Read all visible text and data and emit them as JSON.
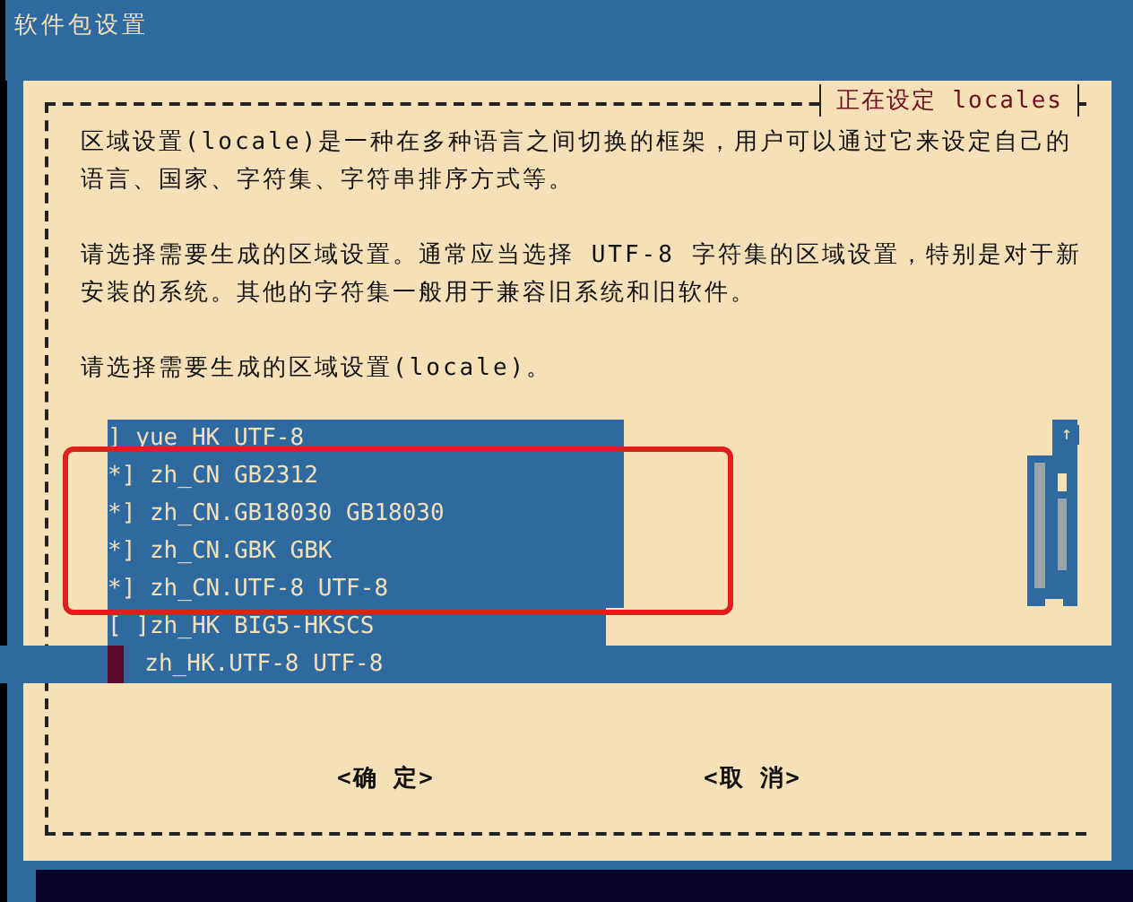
{
  "window": {
    "title": "软件包设置"
  },
  "dialog": {
    "title": "正在设定 locales",
    "paragraphs": [
      "区域设置(locale)是一种在多种语言之间切换的框架，用户可以通过它来设定自己的语言、国家、字符集、字符串排序方式等。",
      "请选择需要生成的区域设置。通常应当选择 UTF-8 字符集的区域设置，特别是对于新安装的系统。其他的字符集一般用于兼容旧系统和旧软件。",
      "请选择需要生成的区域设置(locale)。"
    ],
    "list": [
      {
        "prefix": "]",
        "label": "yue_HK UTF-8",
        "selected": false,
        "highlighted": false
      },
      {
        "prefix": "*]",
        "label": "zh_CN GB2312",
        "selected": false,
        "highlighted": true
      },
      {
        "prefix": "*]",
        "label": "zh_CN.GB18030 GB18030",
        "selected": false,
        "highlighted": true
      },
      {
        "prefix": "*]",
        "label": "zh_CN.GBK GBK",
        "selected": false,
        "highlighted": true
      },
      {
        "prefix": "*]",
        "label": "zh_CN.UTF-8 UTF-8",
        "selected": false,
        "highlighted": true
      },
      {
        "prefix": "[ ]",
        "label": "zh_HK BIG5-HKSCS",
        "selected": false,
        "highlighted": false
      },
      {
        "label": "zh_HK.UTF-8 UTF-8",
        "selected": true,
        "highlighted": false
      }
    ],
    "scroll_up_arrow": "↑",
    "buttons": [
      {
        "label": "<确 定>"
      },
      {
        "label": "<取 消>"
      }
    ]
  }
}
